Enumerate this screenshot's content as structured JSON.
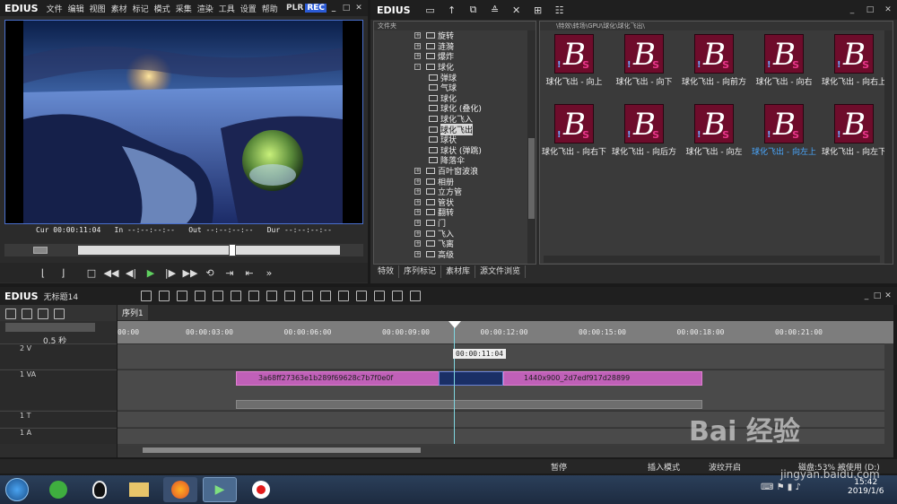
{
  "app": {
    "name": "EDIUS",
    "menu": [
      "文件",
      "编辑",
      "视图",
      "素材",
      "标记",
      "模式",
      "采集",
      "渲染",
      "工具",
      "设置",
      "帮助"
    ],
    "plr": "PLR",
    "rec": "REC"
  },
  "preview": {
    "cur_label": "Cur",
    "cur_value": "00:00:11:04",
    "in_label": "In",
    "in_value": "--:--:--:--",
    "out_label": "Out",
    "out_value": "--:--:--:--",
    "dur_label": "Dur",
    "dur_value": "--:--:--:--"
  },
  "bin": {
    "title": "EDIUS",
    "tree_header": "文件夹",
    "path": "\\特效\\转场\\GPU\\球化\\球化飞出\\",
    "tree": [
      {
        "label": "旋转",
        "indent": 1,
        "expand": "+"
      },
      {
        "label": "涟漪",
        "indent": 1,
        "expand": "+"
      },
      {
        "label": "爆炸",
        "indent": 1,
        "expand": "+"
      },
      {
        "label": "球化",
        "indent": 1,
        "expand": "-"
      },
      {
        "label": "弹球",
        "indent": 2,
        "expand": ""
      },
      {
        "label": "气球",
        "indent": 2,
        "expand": ""
      },
      {
        "label": "球化",
        "indent": 2,
        "expand": ""
      },
      {
        "label": "球化 (叠化)",
        "indent": 2,
        "expand": ""
      },
      {
        "label": "球化飞入",
        "indent": 2,
        "expand": ""
      },
      {
        "label": "球化飞出",
        "indent": 2,
        "expand": "",
        "selected": true
      },
      {
        "label": "球状",
        "indent": 2,
        "expand": ""
      },
      {
        "label": "球状 (弹跳)",
        "indent": 2,
        "expand": ""
      },
      {
        "label": "降落伞",
        "indent": 2,
        "expand": ""
      },
      {
        "label": "百叶窗波浪",
        "indent": 1,
        "expand": "+"
      },
      {
        "label": "相册",
        "indent": 1,
        "expand": "+"
      },
      {
        "label": "立方管",
        "indent": 1,
        "expand": "+"
      },
      {
        "label": "管状",
        "indent": 1,
        "expand": "+"
      },
      {
        "label": "翻转",
        "indent": 1,
        "expand": "+"
      },
      {
        "label": "门",
        "indent": 1,
        "expand": "+"
      },
      {
        "label": "飞入",
        "indent": 1,
        "expand": "+"
      },
      {
        "label": "飞离",
        "indent": 1,
        "expand": "+"
      },
      {
        "label": "高级",
        "indent": 1,
        "expand": "+"
      }
    ],
    "tiles": [
      {
        "label": "球化飞出 - 向上"
      },
      {
        "label": "球化飞出 - 向下"
      },
      {
        "label": "球化飞出 - 向前方"
      },
      {
        "label": "球化飞出 - 向右"
      },
      {
        "label": "球化飞出 - 向右上"
      },
      {
        "label": "球化飞出 - 向右下"
      },
      {
        "label": "球化飞出 - 向后方"
      },
      {
        "label": "球化飞出 - 向左"
      },
      {
        "label": "球化飞出 - 向左上",
        "selected": true
      },
      {
        "label": "球化飞出 - 向左下"
      }
    ],
    "tabs": [
      "特效",
      "序列标记",
      "素材库",
      "源文件浏览"
    ]
  },
  "timeline": {
    "title": "EDIUS",
    "project": "无标题14",
    "sequence_tab": "序列1",
    "zoom": "0.5 秒",
    "ruler": [
      "00:00",
      "00:00:03:00",
      "00:00:06:00",
      "00:00:09:00",
      "00:00:12:00",
      "00:00:15:00",
      "00:00:18:00",
      "00:00:21:00"
    ],
    "cursor_tc": "00:00:11:04",
    "tracks": [
      {
        "name": "2 V"
      },
      {
        "name": "1 VA"
      },
      {
        "name": "1 T"
      },
      {
        "name": "1 A"
      }
    ],
    "clip1": "3a68ff27363e1b289f69628c7b7f0e0f",
    "clip2": "1440x900_2d7edf917d28899"
  },
  "status": {
    "pause": "暂停",
    "insert_mode": "插入模式",
    "ripple": "波纹开启",
    "disk": "磁盘:53% 被使用 (D:)"
  },
  "taskbar": {
    "time": "15:42",
    "date": "2019/1/6"
  },
  "watermark": {
    "text": "Bai 经验",
    "url": "jingyan.baidu.com"
  }
}
